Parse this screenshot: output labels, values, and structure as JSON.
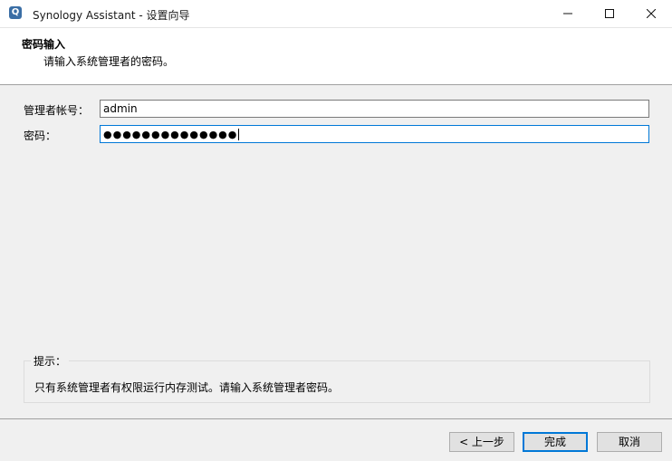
{
  "window": {
    "title": "Synology Assistant  - 设置向导",
    "icon": "synology-assistant-icon"
  },
  "header": {
    "title": "密码输入",
    "subtitle": "请输入系统管理者的密码。"
  },
  "form": {
    "account_label": "管理者帐号：",
    "account_value": "admin",
    "password_label": "密码：",
    "password_value": "●●●●●●●●●●●●●●"
  },
  "hint": {
    "legend": "提示：",
    "text": "只有系统管理者有权限运行内存测试。请输入系统管理者密码。"
  },
  "buttons": {
    "back": "< 上一步",
    "finish": "完成",
    "cancel": "取消"
  }
}
